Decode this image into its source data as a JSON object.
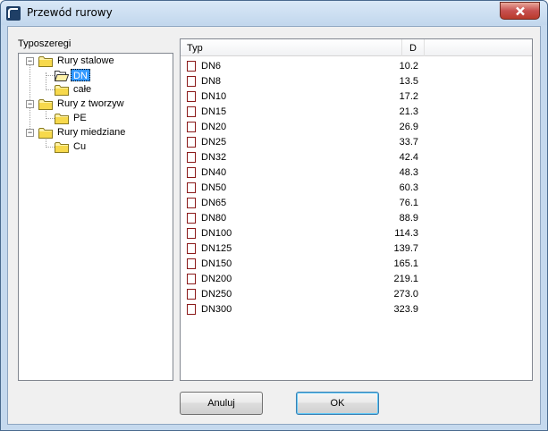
{
  "window": {
    "title": "Przewód rurowy"
  },
  "tree": {
    "label": "Typoszeregi",
    "groups": [
      {
        "label": "Rury stalowe",
        "expander": "−",
        "children": [
          "DN",
          "całe"
        ]
      },
      {
        "label": "Rury z tworzyw",
        "expander": "−",
        "children": [
          "PE"
        ]
      },
      {
        "label": "Rury miedziane",
        "expander": "−",
        "children": [
          "Cu"
        ]
      }
    ],
    "selected": "DN"
  },
  "list": {
    "headers": {
      "typ": "Typ",
      "d": "D"
    },
    "rows": [
      {
        "name": "DN6",
        "value": "10.2"
      },
      {
        "name": "DN8",
        "value": "13.5"
      },
      {
        "name": "DN10",
        "value": "17.2"
      },
      {
        "name": "DN15",
        "value": "21.3"
      },
      {
        "name": "DN20",
        "value": "26.9"
      },
      {
        "name": "DN25",
        "value": "33.7"
      },
      {
        "name": "DN32",
        "value": "42.4"
      },
      {
        "name": "DN40",
        "value": "48.3"
      },
      {
        "name": "DN50",
        "value": "60.3"
      },
      {
        "name": "DN65",
        "value": "76.1"
      },
      {
        "name": "DN80",
        "value": "88.9"
      },
      {
        "name": "DN100",
        "value": "114.3"
      },
      {
        "name": "DN125",
        "value": "139.7"
      },
      {
        "name": "DN150",
        "value": "165.1"
      },
      {
        "name": "DN200",
        "value": "219.1"
      },
      {
        "name": "DN250",
        "value": "273.0"
      },
      {
        "name": "DN300",
        "value": "323.9"
      }
    ]
  },
  "buttons": {
    "cancel": "Anuluj",
    "ok": "OK"
  },
  "icons": {
    "app": "app-icon",
    "close": "close-icon",
    "folder": "folder-icon",
    "open_folder": "folder-open-icon",
    "row": "pipe-item-icon"
  },
  "colors": {
    "selection": "#3399ff",
    "close_button": "#c75050",
    "row_icon_border": "#8b1a1a"
  }
}
